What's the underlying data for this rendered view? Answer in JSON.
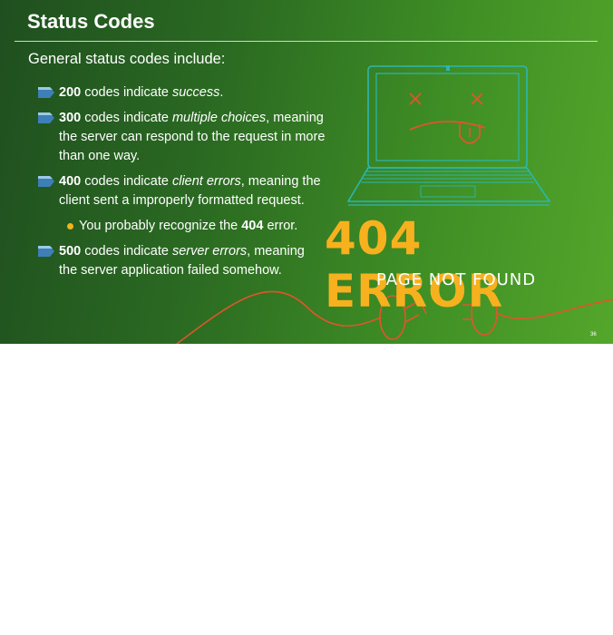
{
  "slide": {
    "title": "Status Codes",
    "subtitle": "General status codes include:",
    "bullets": [
      {
        "code": "200",
        "before": " codes indicate ",
        "emph": "success",
        "after": "."
      },
      {
        "code": "300",
        "before": " codes indicate ",
        "emph": "multiple choices",
        "after": ", meaning the server can respond to the request in more than one way."
      },
      {
        "code": "400",
        "before": " codes indicate ",
        "emph": "client errors",
        "after": ", meaning the client sent a improperly formatted request."
      },
      {
        "code": "500",
        "before": " codes indicate ",
        "emph": "server errors",
        "after": ", meaning the server application failed somehow."
      }
    ],
    "sub_bullet": {
      "before": "You probably recognize the ",
      "code": "404",
      "after": " error."
    },
    "page_number": "36"
  },
  "illustration": {
    "error_text": "404 ERROR",
    "subtext": "PAGE NOT FOUND"
  },
  "colors": {
    "accent_orange": "#f7b11e",
    "cable_red": "#e0562a",
    "laptop_cyan": "#2cb6b0"
  }
}
